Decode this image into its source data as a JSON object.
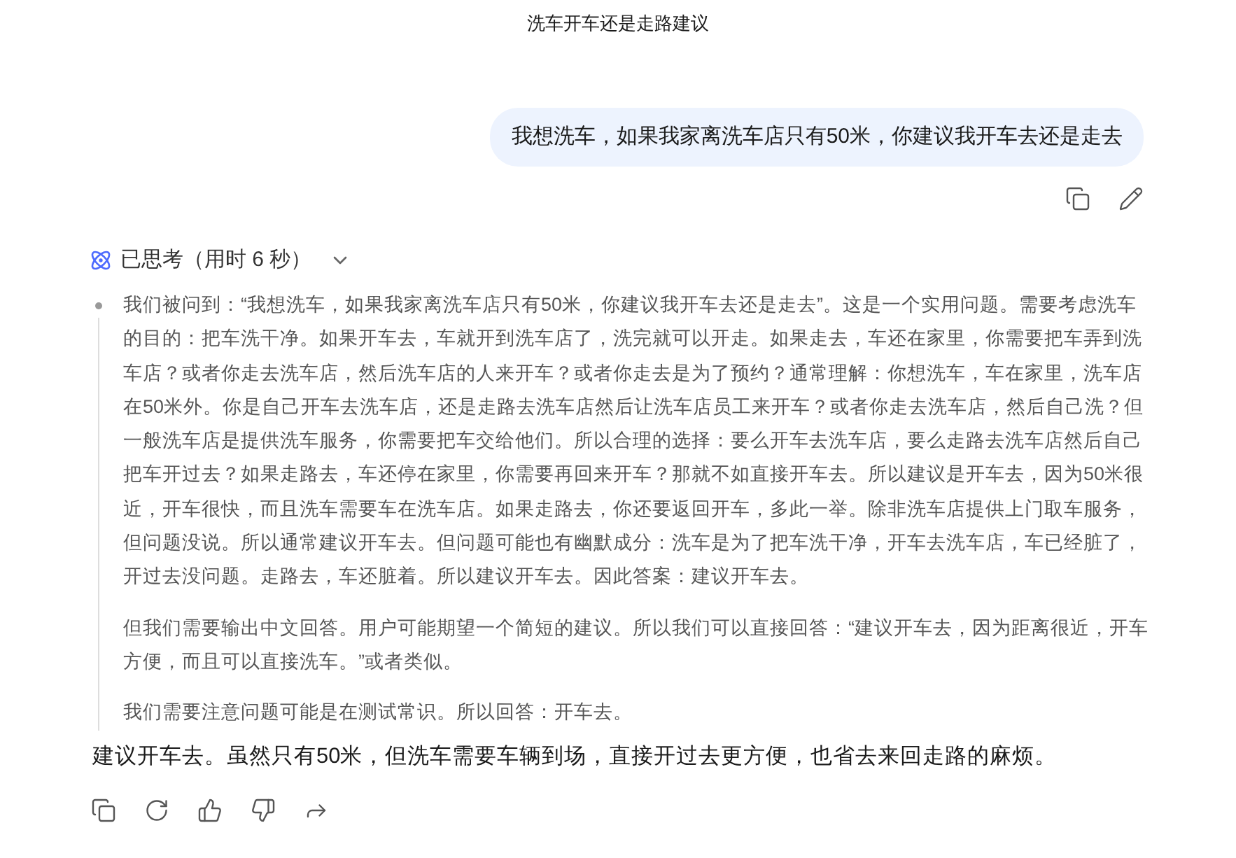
{
  "title": "洗车开车还是走路建议",
  "user_message": {
    "text": "我想洗车，如果我家离洗车店只有50米，你建议我开车去还是走去"
  },
  "thinking": {
    "label": "已思考（用时 6 秒）",
    "expanded": true,
    "paragraphs": [
      "我们被问到：“我想洗车，如果我家离洗车店只有50米，你建议我开车去还是走去”。这是一个实用问题。需要考虑洗车的目的：把车洗干净。如果开车去，车就开到洗车店了，洗完就可以开走。如果走去，车还在家里，你需要把车弄到洗车店？或者你走去洗车店，然后洗车店的人来开车？或者你走去是为了预约？通常理解：你想洗车，车在家里，洗车店在50米外。你是自己开车去洗车店，还是走路去洗车店然后让洗车店员工来开车？或者你走去洗车店，然后自己洗？但一般洗车店是提供洗车服务，你需要把车交给他们。所以合理的选择：要么开车去洗车店，要么走路去洗车店然后自己把车开过去？如果走路去，车还停在家里，你需要再回来开车？那就不如直接开车去。所以建议是开车去，因为50米很近，开车很快，而且洗车需要车在洗车店。如果走路去，你还要返回开车，多此一举。除非洗车店提供上门取车服务，但问题没说。所以通常建议开车去。但问题可能也有幽默成分：洗车是为了把车洗干净，开车去洗车店，车已经脏了，开过去没问题。走路去，车还脏着。所以建议开车去。因此答案：建议开车去。",
      "但我们需要输出中文回答。用户可能期望一个简短的建议。所以我们可以直接回答：“建议开车去，因为距离很近，开车方便，而且可以直接洗车。”或者类似。",
      "我们需要注意问题可能是在测试常识。所以回答：开车去。"
    ]
  },
  "answer": {
    "text": "建议开车去。虽然只有50米，但洗车需要车辆到场，直接开过去更方便，也省去来回走路的麻烦。"
  }
}
